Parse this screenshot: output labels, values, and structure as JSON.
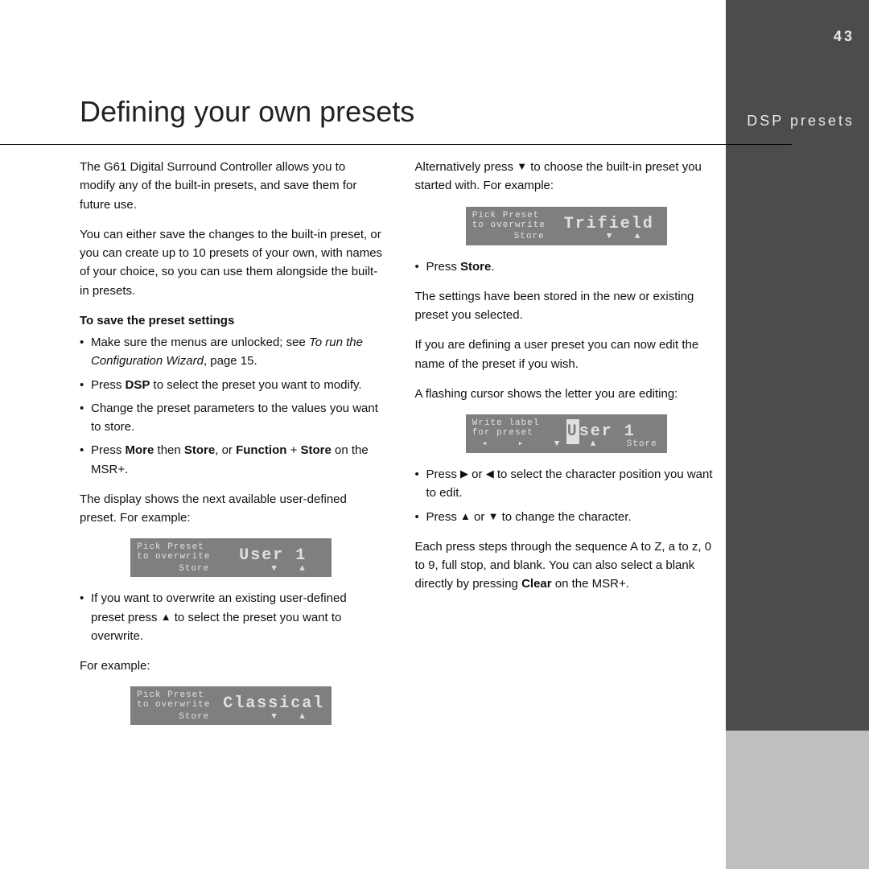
{
  "page_number": "43",
  "sidebar_label": "DSP presets",
  "title": "Defining your own presets",
  "col1": {
    "intro1": "The G61 Digital Surround Controller allows you to modify any of the built-in presets, and save them for future use.",
    "intro2": "You can either save the changes to the built-in preset, or you can create up to 10 presets of your own, with names of your choice, so you can use them alongside the built-in presets.",
    "subhead": "To save the preset settings",
    "b1a": "Make sure the menus are unlocked; see ",
    "b1b": "To run the Configuration Wizard",
    "b1c": ", page 15.",
    "b2a": "Press ",
    "b2b": "DSP",
    "b2c": " to select the preset you want to modify.",
    "b3": "Change the preset parameters to the values you want to store.",
    "b4a": "Press ",
    "b4b": "More",
    "b4c": " then ",
    "b4d": "Store",
    "b4e": ", or ",
    "b4f": "Function",
    "b4g": " + ",
    "b4h": "Store",
    "b4i": " on the MSR+.",
    "para1": "The display shows the next available user-defined preset. For example:",
    "b5a": "If you want to overwrite an existing user-defined preset press ",
    "b5b": " to select the preset you want to overwrite.",
    "para2": "For example:"
  },
  "col2": {
    "p1a": "Alternatively press ",
    "p1b": " to choose the built-in preset you started with. For example:",
    "b1a": "Press ",
    "b1b": "Store",
    "b1c": ".",
    "p2": "The settings have been stored in the new or existing preset you selected.",
    "p3": "If you are defining a user preset you can now edit the name of the preset if you wish.",
    "p4": "A flashing cursor shows the letter you are editing:",
    "b2a": "Press ",
    "b2b": " or ",
    "b2c": " to select the character position you want to edit.",
    "b3a": "Press ",
    "b3b": " or ",
    "b3c": " to change the character.",
    "p5a": "Each press steps through the sequence A to Z, a to z, 0 to 9, full stop, and blank. You can also select a blank directly by pressing ",
    "p5b": "Clear",
    "p5c": " on the MSR+."
  },
  "lcd1": {
    "l1": "Pick Preset",
    "l2": "to overwrite",
    "main": "User 1",
    "store": "Store"
  },
  "lcd2": {
    "l1": "Pick Preset",
    "l2": "to overwrite",
    "main": "Classical",
    "store": "Store"
  },
  "lcd3": {
    "l1": "Pick Preset",
    "l2": "to overwrite",
    "main": "Trifield",
    "store": "Store"
  },
  "lcd4": {
    "l1": "Write label",
    "l2": "for preset",
    "main_prefix": "U",
    "main_rest": "ser 1",
    "store": "Store"
  },
  "symbols": {
    "up": "▲",
    "down": "▼",
    "left": "◀",
    "right": "▶",
    "bullet": "•",
    "barleft": "◂",
    "barright": "▸"
  }
}
